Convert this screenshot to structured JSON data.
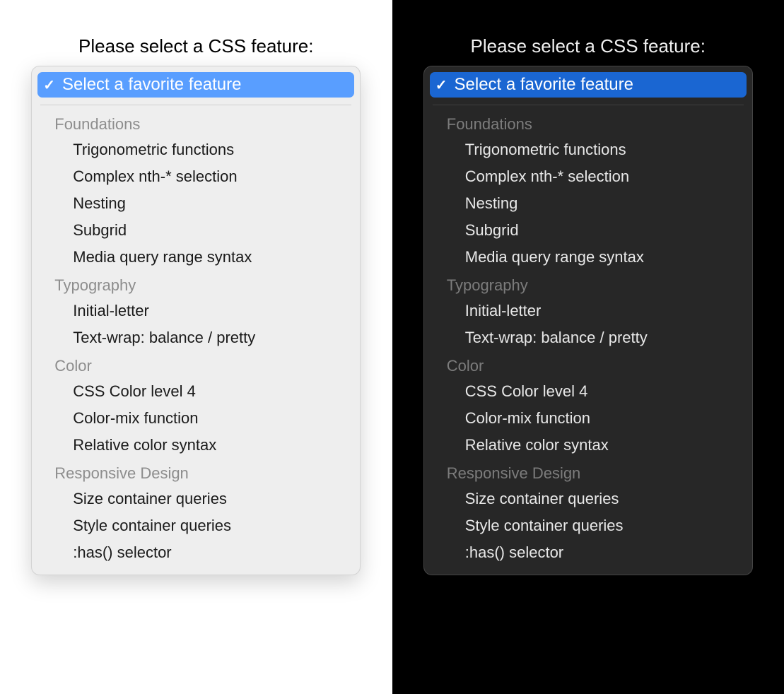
{
  "heading": "Please select a CSS feature:",
  "selected": "Select a favorite feature",
  "colors": {
    "light_highlight": "#599eff",
    "dark_highlight": "#1a66d2"
  },
  "groups": [
    {
      "label": "Foundations",
      "items": [
        "Trigonometric functions",
        "Complex nth-* selection",
        "Nesting",
        "Subgrid",
        "Media query range syntax"
      ]
    },
    {
      "label": "Typography",
      "items": [
        "Initial-letter",
        "Text-wrap: balance / pretty"
      ]
    },
    {
      "label": "Color",
      "items": [
        "CSS Color level 4",
        "Color-mix function",
        "Relative color syntax"
      ]
    },
    {
      "label": "Responsive Design",
      "items": [
        "Size container queries",
        "Style container queries",
        ":has() selector"
      ]
    }
  ]
}
